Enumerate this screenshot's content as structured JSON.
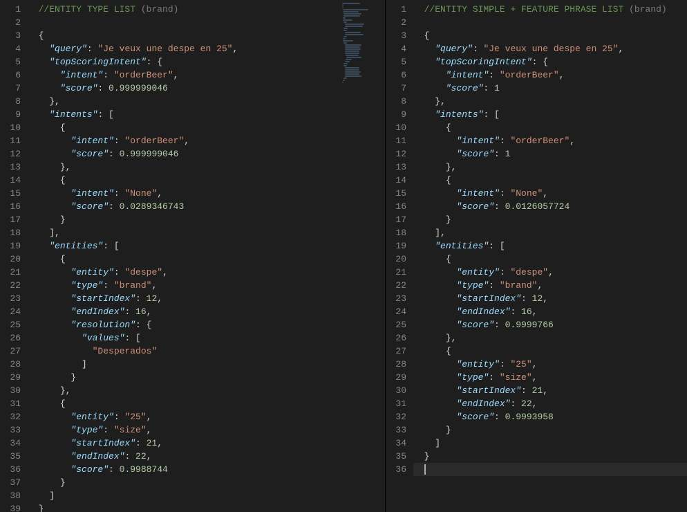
{
  "left": {
    "title_comment": "//ENTITY TYPE LIST ",
    "title_hint": "(brand)",
    "json": {
      "query": "Je veux une despe en 25",
      "topScoringIntent": {
        "intent": "orderBeer",
        "score": 0.999999046
      },
      "intents": [
        {
          "intent": "orderBeer",
          "score": 0.999999046
        },
        {
          "intent": "None",
          "score": 0.0289346743
        }
      ],
      "entities": [
        {
          "entity": "despe",
          "type": "brand",
          "startIndex": 12,
          "endIndex": 16,
          "resolution": {
            "values": [
              "Desperados"
            ]
          }
        },
        {
          "entity": "25",
          "type": "size",
          "startIndex": 21,
          "endIndex": 22,
          "score": 0.9988744
        }
      ]
    },
    "line_count": 39
  },
  "right": {
    "title_comment": "//ENTITY SIMPLE + FEATURE PHRASE LIST ",
    "title_hint": "(brand)",
    "json": {
      "query": "Je veux une despe en 25",
      "topScoringIntent": {
        "intent": "orderBeer",
        "score": 1.0
      },
      "intents": [
        {
          "intent": "orderBeer",
          "score": 1.0
        },
        {
          "intent": "None",
          "score": 0.0126057724
        }
      ],
      "entities": [
        {
          "entity": "despe",
          "type": "brand",
          "startIndex": 12,
          "endIndex": 16,
          "score": 0.9999766
        },
        {
          "entity": "25",
          "type": "size",
          "startIndex": 21,
          "endIndex": 22,
          "score": 0.9993958
        }
      ]
    },
    "line_count": 36,
    "cursor_line": 36
  }
}
